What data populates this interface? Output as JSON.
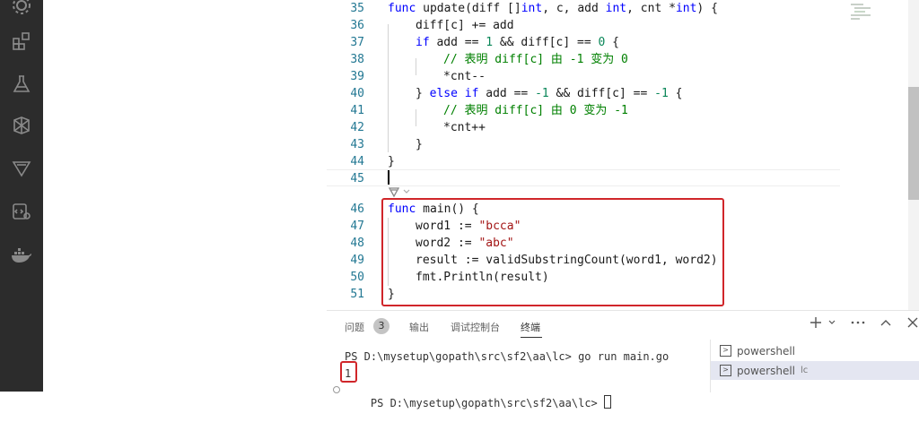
{
  "editor": {
    "lines": [
      {
        "ln": "35",
        "indent": 0,
        "tokens": [
          {
            "t": "func",
            "c": "kw"
          },
          {
            "t": " update(diff []"
          },
          {
            "t": "int",
            "c": "kw"
          },
          {
            "t": ", c, add "
          },
          {
            "t": "int",
            "c": "kw"
          },
          {
            "t": ", cnt *"
          },
          {
            "t": "int",
            "c": "kw"
          },
          {
            "t": ") {"
          }
        ]
      },
      {
        "ln": "36",
        "indent": 1,
        "tokens": [
          {
            "t": "diff[c] += add"
          }
        ]
      },
      {
        "ln": "37",
        "indent": 1,
        "tokens": [
          {
            "t": "if",
            "c": "kw"
          },
          {
            "t": " add == "
          },
          {
            "t": "1",
            "c": "num"
          },
          {
            "t": " && diff[c] == "
          },
          {
            "t": "0",
            "c": "num"
          },
          {
            "t": " {"
          }
        ]
      },
      {
        "ln": "38",
        "indent": 2,
        "tokens": [
          {
            "t": "// 表明 diff[c] 由 -1 变为 0",
            "c": "cmt"
          }
        ]
      },
      {
        "ln": "39",
        "indent": 2,
        "tokens": [
          {
            "t": "*cnt--"
          }
        ]
      },
      {
        "ln": "40",
        "indent": 1,
        "tokens": [
          {
            "t": "} "
          },
          {
            "t": "else",
            "c": "kw"
          },
          {
            "t": " "
          },
          {
            "t": "if",
            "c": "kw"
          },
          {
            "t": " add == "
          },
          {
            "t": "-1",
            "c": "num"
          },
          {
            "t": " && diff[c] == "
          },
          {
            "t": "-1",
            "c": "num"
          },
          {
            "t": " {"
          }
        ]
      },
      {
        "ln": "41",
        "indent": 2,
        "tokens": [
          {
            "t": "// 表明 diff[c] 由 0 变为 -1",
            "c": "cmt"
          }
        ]
      },
      {
        "ln": "42",
        "indent": 2,
        "tokens": [
          {
            "t": "*cnt++"
          }
        ]
      },
      {
        "ln": "43",
        "indent": 1,
        "tokens": [
          {
            "t": "}"
          }
        ]
      },
      {
        "ln": "44",
        "indent": 0,
        "tokens": [
          {
            "t": "}"
          }
        ]
      },
      {
        "ln": "45",
        "indent": 0,
        "tokens": []
      },
      {
        "ln": "46",
        "indent": 0,
        "tokens": [
          {
            "t": "func",
            "c": "kw"
          },
          {
            "t": " main() {"
          }
        ]
      },
      {
        "ln": "47",
        "indent": 1,
        "tokens": [
          {
            "t": "word1 := "
          },
          {
            "t": "\"bcca\"",
            "c": "str"
          }
        ]
      },
      {
        "ln": "48",
        "indent": 1,
        "tokens": [
          {
            "t": "word2 := "
          },
          {
            "t": "\"abc\"",
            "c": "str"
          }
        ]
      },
      {
        "ln": "49",
        "indent": 1,
        "tokens": [
          {
            "t": "result := validSubstringCount(word1, word2)"
          }
        ]
      },
      {
        "ln": "50",
        "indent": 1,
        "tokens": [
          {
            "t": "fmt.Println(result)"
          }
        ]
      },
      {
        "ln": "51",
        "indent": 0,
        "tokens": [
          {
            "t": "}"
          }
        ]
      }
    ]
  },
  "activity_icons": [
    "settings-gear-icon",
    "extensions-icon",
    "testing-flask-icon",
    "git-graph-icon",
    "gitlens-icon",
    "remote-explorer-icon",
    "docker-icon"
  ],
  "panel": {
    "tabs": [
      "问题",
      "输出",
      "调试控制台",
      "终端"
    ],
    "problems_count": "3",
    "active_tab": "终端",
    "terminal_lines": [
      "PS D:\\mysetup\\gopath\\src\\sf2\\aa\\lc> go run main.go",
      "1",
      "PS D:\\mysetup\\gopath\\src\\sf2\\aa\\lc> "
    ],
    "terminals": [
      {
        "label": "powershell",
        "suffix": ""
      },
      {
        "label": "powershell",
        "suffix": "lc"
      }
    ]
  },
  "colors": {
    "activity_bg": "#2c2c2c",
    "highlight": "#d0262a",
    "keyword": "#0000ff",
    "string": "#a31515",
    "comment": "#008000",
    "number": "#098658"
  }
}
